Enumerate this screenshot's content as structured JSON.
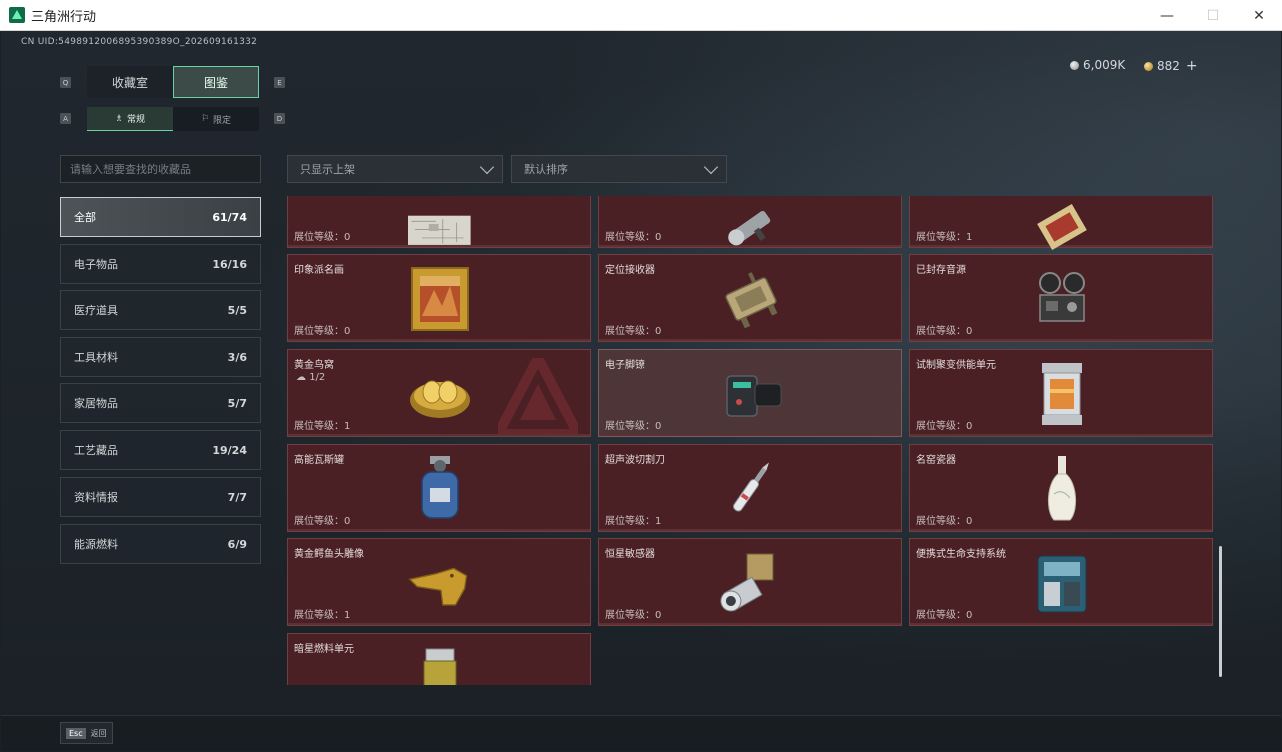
{
  "window": {
    "title": "三角洲行动",
    "controls": {
      "minimize": "—",
      "maximize": "☐",
      "close": "✕"
    }
  },
  "header": {
    "uid": "CN UID:5498912006895390389O_202609161332",
    "currency": {
      "silver": "6,009K",
      "gold": "882",
      "add": "+"
    }
  },
  "tabs": {
    "key_left": "Q",
    "key_right": "E",
    "items": [
      {
        "label": "收藏室"
      },
      {
        "label": "图鉴"
      }
    ]
  },
  "subtabs": {
    "key_left": "A",
    "key_right": "D",
    "items": [
      {
        "label": "常规",
        "icon": "♗"
      },
      {
        "label": "限定",
        "icon": "⚐"
      }
    ]
  },
  "search": {
    "placeholder": "请输入想要查找的收藏品"
  },
  "filters": {
    "display": "只显示上架",
    "sort": "默认排序"
  },
  "categories": [
    {
      "label": "全部",
      "count": "61/74"
    },
    {
      "label": "电子物品",
      "count": "16/16"
    },
    {
      "label": "医疗道具",
      "count": "5/5"
    },
    {
      "label": "工具材料",
      "count": "3/6"
    },
    {
      "label": "家居物品",
      "count": "5/7"
    },
    {
      "label": "工艺藏品",
      "count": "19/24"
    },
    {
      "label": "资料情报",
      "count": "7/7"
    },
    {
      "label": "能源燃料",
      "count": "6/9"
    }
  ],
  "items": [
    {
      "name": "",
      "level": "展位等级：0",
      "icon": "map-icon"
    },
    {
      "name": "",
      "level": "展位等级：0",
      "icon": "flashlight-icon"
    },
    {
      "name": "",
      "level": "展位等级：1",
      "icon": "tapestry-icon"
    },
    {
      "name": "印象派名画",
      "level": "展位等级：0",
      "icon": "painting-icon"
    },
    {
      "name": "定位接收器",
      "level": "展位等级：0",
      "icon": "gps-receiver-icon"
    },
    {
      "name": "已封存音源",
      "level": "展位等级：0",
      "icon": "film-projector-icon"
    },
    {
      "name": "黄金鸟窝",
      "level": "展位等级：1",
      "progress": "1/2",
      "icon": "golden-nest-icon"
    },
    {
      "name": "电子脚镣",
      "level": "展位等级：0",
      "icon": "ankle-monitor-icon"
    },
    {
      "name": "试制聚变供能单元",
      "level": "展位等级：0",
      "icon": "fusion-cell-icon"
    },
    {
      "name": "高能瓦斯罐",
      "level": "展位等级：0",
      "icon": "gas-canister-icon"
    },
    {
      "name": "超声波切割刀",
      "level": "展位等级：1",
      "icon": "ultrasonic-knife-icon"
    },
    {
      "name": "名窑瓷器",
      "level": "展位等级：0",
      "icon": "porcelain-vase-icon"
    },
    {
      "name": "黄金鳄鱼头雕像",
      "level": "展位等级：1",
      "icon": "gold-crocodile-icon"
    },
    {
      "name": "恒星敏感器",
      "level": "展位等级：0",
      "icon": "star-sensor-icon"
    },
    {
      "name": "便携式生命支持系统",
      "level": "展位等级：0",
      "icon": "life-support-icon"
    },
    {
      "name": "暗星燃料单元",
      "level": "",
      "icon": "fuel-cell-icon"
    }
  ],
  "footer": {
    "esc_key": "Esc",
    "esc_label": "返回"
  },
  "colors": {
    "accent": "#6ad1a6",
    "card_bg": "#4b2024",
    "card_border": "#6f3f42"
  }
}
